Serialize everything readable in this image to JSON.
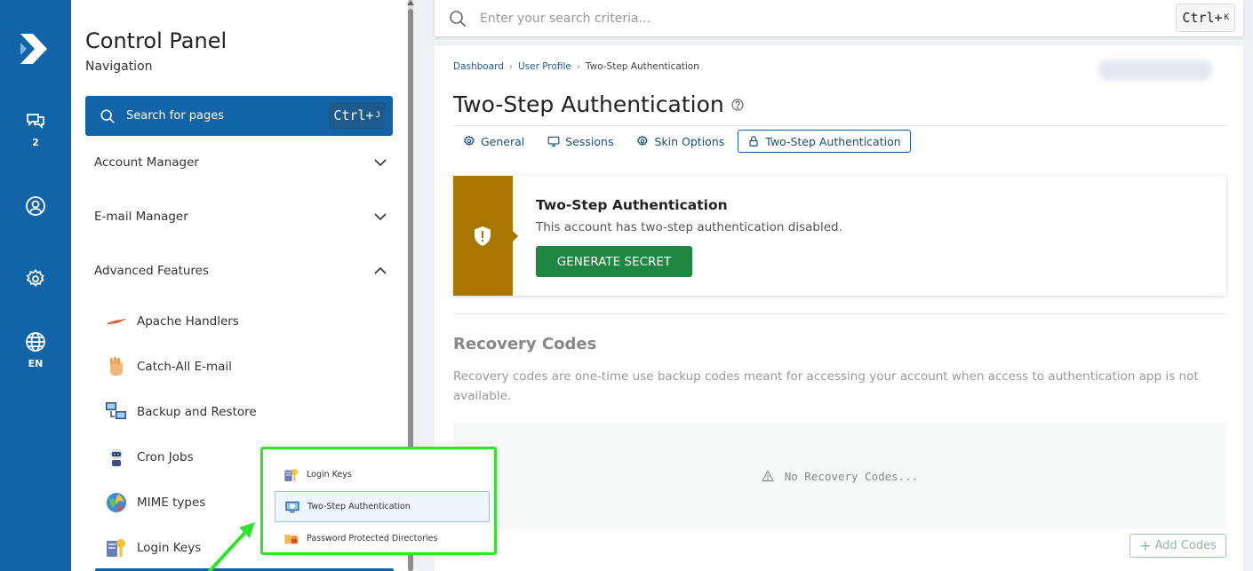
{
  "rail": {
    "chat_count": "2",
    "language": "EN"
  },
  "nav": {
    "title": "Control Panel",
    "subtitle": "Navigation",
    "search_label": "Search for pages",
    "search_shortcut": "Ctrl+",
    "search_shortcut_key": "J",
    "groups": [
      {
        "label": "Account Manager",
        "expanded": false
      },
      {
        "label": "E-mail Manager",
        "expanded": false
      },
      {
        "label": "Advanced Features",
        "expanded": true
      }
    ],
    "links": [
      {
        "label": "Apache Handlers",
        "icon": "apache-feather-icon"
      },
      {
        "label": "Catch-All E-mail",
        "icon": "hand-icon"
      },
      {
        "label": "Backup and Restore",
        "icon": "computers-icon"
      },
      {
        "label": "Cron Jobs",
        "icon": "robot-icon"
      },
      {
        "label": "MIME types",
        "icon": "globe-icon"
      },
      {
        "label": "Login Keys",
        "icon": "key-icon"
      }
    ]
  },
  "topbar": {
    "search_placeholder": "Enter your search criteria...",
    "shortcut": "Ctrl+",
    "shortcut_key": "K"
  },
  "main": {
    "breadcrumbs": [
      "Dashboard",
      "User Profile",
      "Two-Step Authentication"
    ],
    "title": "Two-Step Authentication",
    "tabs": [
      {
        "label": "General",
        "icon": "gear-icon",
        "active": false
      },
      {
        "label": "Sessions",
        "icon": "monitor-icon",
        "active": false
      },
      {
        "label": "Skin Options",
        "icon": "gear-icon",
        "active": false
      },
      {
        "label": "Two-Step Authentication",
        "icon": "lock-icon",
        "active": true
      }
    ],
    "tfa": {
      "heading": "Two-Step Authentication",
      "description": "This account has two-step authentication disabled.",
      "button": "GENERATE SECRET"
    },
    "recovery": {
      "title": "Recovery Codes",
      "description": "Recovery codes are one-time use backup codes meant for accessing your account when access to authentication app is not available.",
      "empty": "No Recovery Codes...",
      "add_button": "Add Codes"
    }
  },
  "popup": {
    "items": [
      {
        "label": "Login Keys",
        "highlighted": false
      },
      {
        "label": "Two-Step Authentication",
        "highlighted": true
      },
      {
        "label": "Password Protected Directories",
        "highlighted": false
      }
    ]
  },
  "colors": {
    "brand": "#1164a8",
    "warning": "#a97600",
    "success": "#1f8741",
    "annotation": "#2ee52b"
  }
}
